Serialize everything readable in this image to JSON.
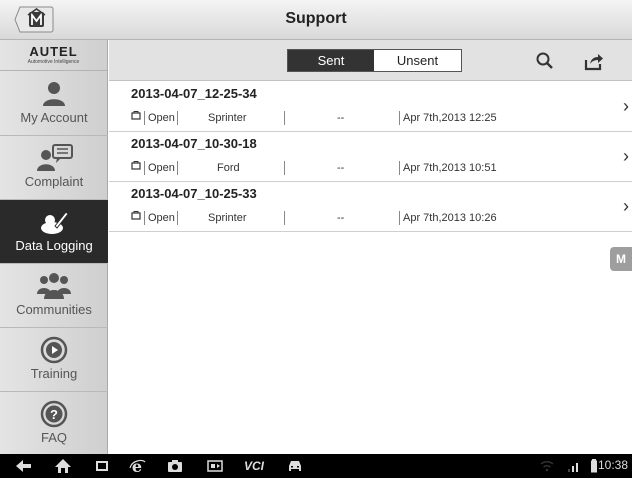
{
  "app": {
    "title": "Support"
  },
  "brand": {
    "name": "AUTEL",
    "tagline": "Automotive Intelligence"
  },
  "sidebar": {
    "items": [
      {
        "label": "My Account",
        "icon": "person-icon"
      },
      {
        "label": "Complaint",
        "icon": "complaint-icon"
      },
      {
        "label": "Data Logging",
        "icon": "data-logging-icon",
        "active": true
      },
      {
        "label": "Communities",
        "icon": "people-icon"
      },
      {
        "label": "Training",
        "icon": "play-icon"
      },
      {
        "label": "FAQ",
        "icon": "question-icon"
      }
    ]
  },
  "toolbar": {
    "sent_label": "Sent",
    "unsent_label": "Unsent",
    "selected": "Sent"
  },
  "records": [
    {
      "title": "2013-04-07_12-25-34",
      "status": "Open",
      "vehicle": "Sprinter",
      "placeholder": "--",
      "date": "Apr 7th,2013 12:25"
    },
    {
      "title": "2013-04-07_10-30-18",
      "status": "Open",
      "vehicle": "Ford",
      "placeholder": "--",
      "date": "Apr 7th,2013 10:51"
    },
    {
      "title": "2013-04-07_10-25-33",
      "status": "Open",
      "vehicle": "Sprinter",
      "placeholder": "--",
      "date": "Apr 7th,2013 10:26"
    }
  ],
  "float_button": {
    "label": "M"
  },
  "statusbar": {
    "time": "10:38",
    "vci_label": "VCI"
  },
  "colors": {
    "active_nav": "#2a2a2a",
    "seg_selected": "#333333",
    "navbar": "#000000"
  }
}
